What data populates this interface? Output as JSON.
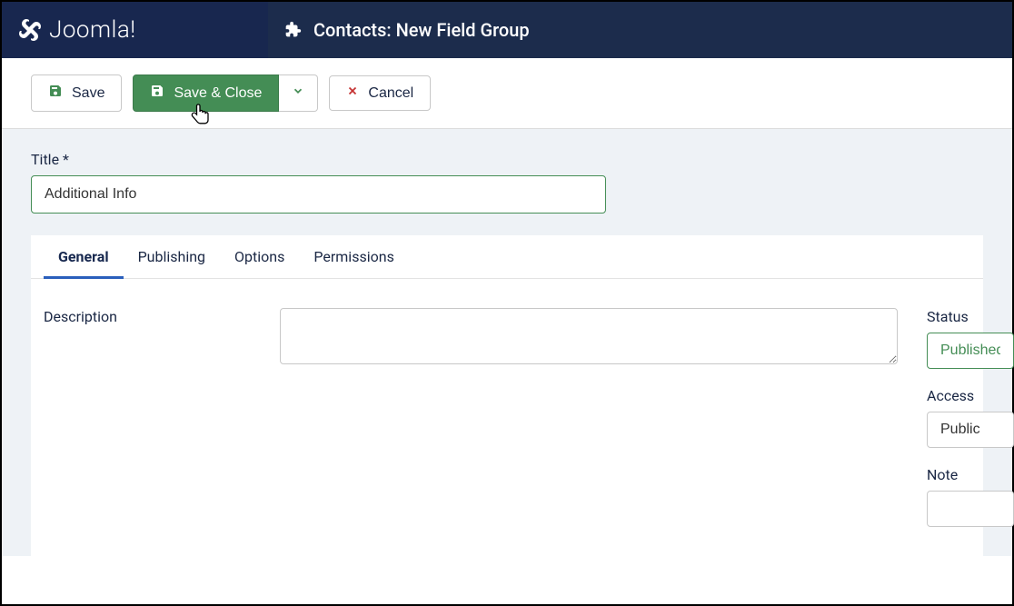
{
  "brand": "Joomla!",
  "page_title": "Contacts: New Field Group",
  "toolbar": {
    "save": "Save",
    "save_close": "Save & Close",
    "cancel": "Cancel"
  },
  "form": {
    "title_label": "Title *",
    "title_value": "Additional Info"
  },
  "tabs": [
    "General",
    "Publishing",
    "Options",
    "Permissions"
  ],
  "active_tab": 0,
  "fields": {
    "description_label": "Description",
    "description_value": "",
    "status_label": "Status",
    "status_value": "Published",
    "access_label": "Access",
    "access_value": "Public",
    "note_label": "Note",
    "note_value": ""
  }
}
